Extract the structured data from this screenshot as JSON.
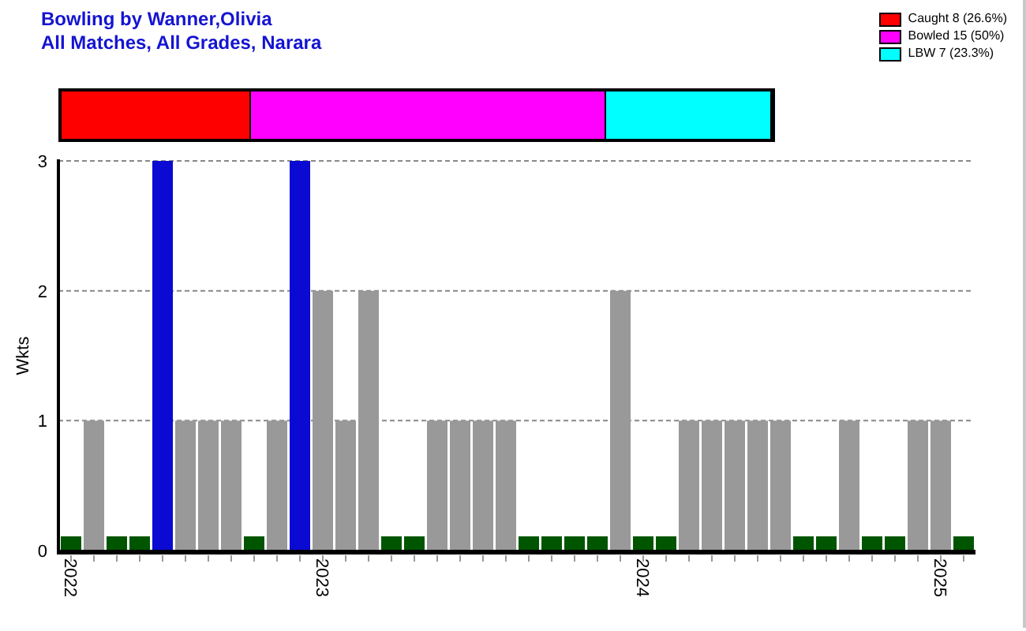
{
  "title": {
    "line_1": "Bowling by Wanner,Olivia",
    "line_2": "All Matches, All Grades, Narara"
  },
  "legend": [
    {
      "label": "Caught 8 (26.6%)",
      "color": "#ff0000",
      "level": 0.266
    },
    {
      "label": "Bowled 15 (50%)",
      "color": "#ff00ff",
      "level": 0.5
    },
    {
      "label": "LBW 7 (23.3%)",
      "color": "#00ffff",
      "level": 0.234
    }
  ],
  "chart": {
    "chart_data": {
      "type": "bar",
      "ylabel": "Wkts",
      "ylim": [
        0,
        3
      ],
      "yticks": [
        {
          "value": 0,
          "label": "0"
        },
        {
          "value": 1,
          "label": "1"
        },
        {
          "value": 2,
          "label": "2"
        },
        {
          "value": 3,
          "label": "3"
        }
      ],
      "categories": [
        "2022",
        null,
        null,
        null,
        null,
        null,
        null,
        null,
        null,
        null,
        null,
        "2023",
        null,
        null,
        null,
        null,
        null,
        null,
        null,
        null,
        null,
        null,
        null,
        null,
        null,
        "2024",
        null,
        null,
        null,
        null,
        null,
        null,
        null,
        null,
        null,
        null,
        null,
        null,
        "2025",
        null
      ],
      "series": [
        {
          "color": "#999999",
          "values": [
            0,
            1,
            0,
            0,
            null,
            1,
            1,
            1,
            0,
            1,
            null,
            2,
            1,
            2,
            0,
            0,
            1,
            1,
            1,
            1,
            0,
            0,
            0,
            0,
            2,
            0,
            0,
            1,
            1,
            1,
            1,
            1,
            0,
            0,
            1,
            0,
            0,
            1,
            1,
            0
          ]
        },
        {
          "color": "#0a0ad2",
          "values": [
            null,
            null,
            null,
            null,
            3,
            null,
            null,
            null,
            null,
            null,
            3,
            null,
            null,
            null,
            null,
            null,
            null,
            null,
            null,
            null,
            null,
            null,
            null,
            null,
            null,
            null,
            null,
            null,
            null,
            null,
            null,
            null,
            null,
            null,
            null,
            null,
            null,
            null,
            null,
            null
          ]
        }
      ]
    }
  }
}
